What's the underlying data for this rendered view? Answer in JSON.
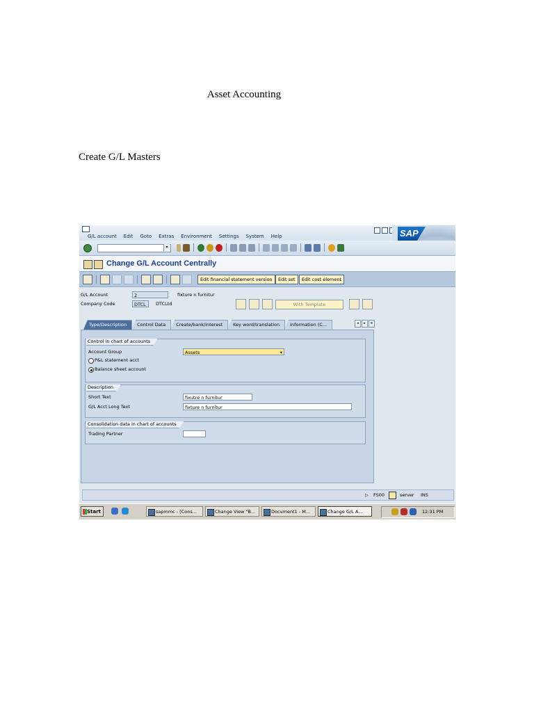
{
  "document": {
    "title": "Asset Accounting",
    "heading": "Create G/L Masters"
  },
  "sap": {
    "logo": "SAP",
    "menu": [
      "G/L account",
      "Edit",
      "Goto",
      "Extras",
      "Environment",
      "Settings",
      "System",
      "Help"
    ],
    "screen_title": "Change G/L Account Centrally",
    "app_buttons": {
      "edit_fs_version": "Edit financial statement version",
      "edit_set": "Edit set",
      "edit_cost_element": "Edit cost element"
    },
    "header_fields": {
      "gl_account_label": "G/L Account",
      "gl_account_value": "2",
      "gl_account_desc": "fixture n furnitur",
      "company_code_label": "Company Code",
      "company_code_value": "DTCL",
      "company_code_desc": "DTCLtd",
      "with_template": "With Template"
    },
    "tabs": [
      "Type/Description",
      "Control Data",
      "Create/bank/interest",
      "Key word/translation",
      "Information (C..."
    ],
    "groups": {
      "control": {
        "title": "Control in chart of accounts",
        "account_group_label": "Account Group",
        "account_group_value": "Assets",
        "pl_label": "P&L statement acct",
        "bs_label": "Balance sheet account",
        "selected": "Balance sheet account"
      },
      "description": {
        "title": "Description",
        "short_text_label": "Short Text",
        "short_text_value": "fixutre n furnitur",
        "long_text_label": "G/L Acct Long Text",
        "long_text_value": "fixture n furnitur"
      },
      "consolidation": {
        "title": "Consolidation data in chart of accounts",
        "trading_partner_label": "Trading Partner",
        "trading_partner_value": ""
      }
    },
    "status": {
      "transaction": "FS00",
      "server": "server",
      "mode": "INS"
    },
    "taskbar": {
      "start": "Start",
      "items": [
        "sapmmc - [Cons...",
        "Change View \"B...",
        "Document1 - M...",
        "Change G/L A..."
      ],
      "clock": "12:31 PM"
    }
  }
}
